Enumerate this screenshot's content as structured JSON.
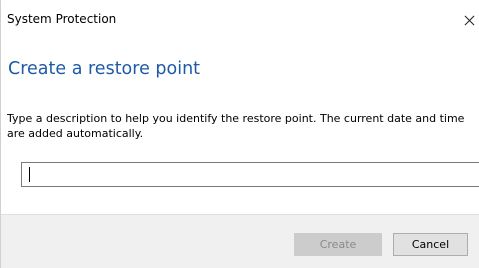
{
  "window": {
    "title": "System Protection"
  },
  "dialog": {
    "heading": "Create a restore point",
    "description": "Type a description to help you identify the restore point. The current date and time are added automatically.",
    "input": {
      "value": "",
      "placeholder": ""
    }
  },
  "buttons": {
    "create_label": "Create",
    "create_enabled": false,
    "cancel_label": "Cancel"
  },
  "icons": {
    "close": "close-icon"
  },
  "colors": {
    "heading": "#1e5aa8",
    "footer_bg": "#f0f0f0",
    "disabled_button_bg": "#cccccc",
    "disabled_button_text": "#8a8a8a"
  }
}
